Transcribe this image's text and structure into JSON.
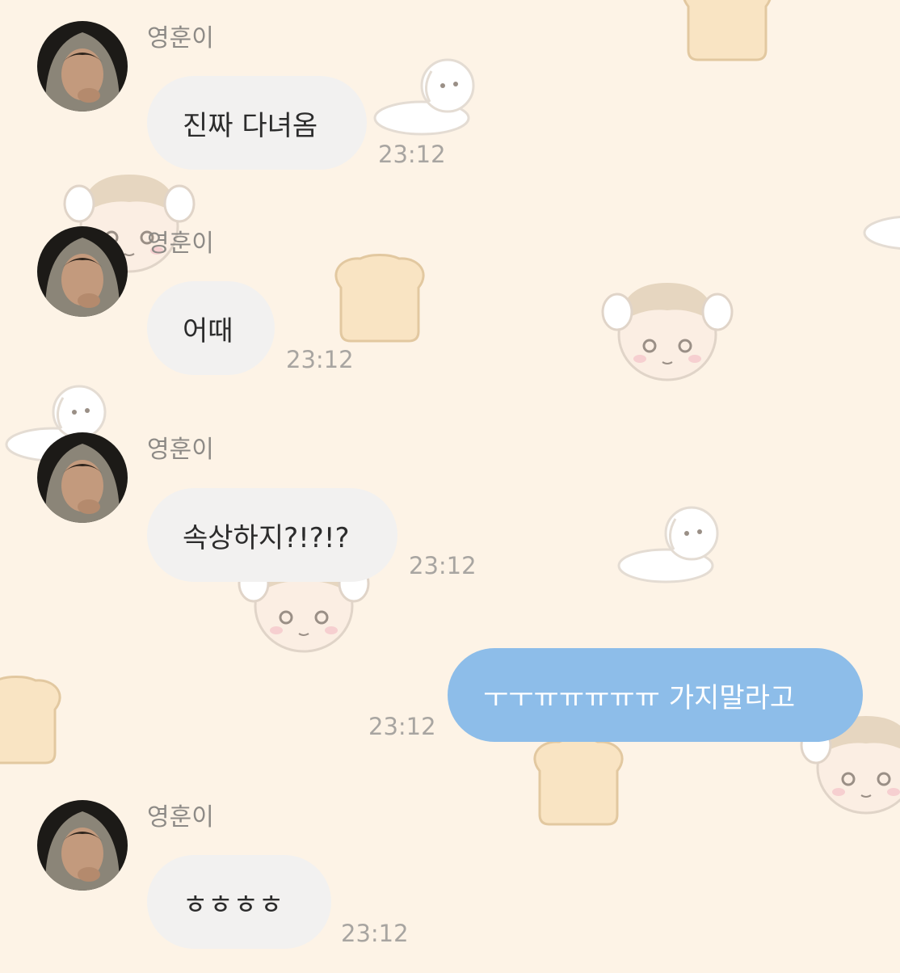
{
  "chat": {
    "messages": [
      {
        "sender": "영훈이",
        "text": "진짜 다녀옴",
        "time": "23:12",
        "direction": "incoming"
      },
      {
        "sender": "영훈이",
        "text": "어때",
        "time": "23:12",
        "direction": "incoming"
      },
      {
        "sender": "영훈이",
        "text": "속상하지?!?!?",
        "time": "23:12",
        "direction": "incoming"
      },
      {
        "text": "ㅜㅜㅠㅠㅠㅠㅠ 가지말라고",
        "time": "23:12",
        "direction": "outgoing"
      },
      {
        "sender": "영훈이",
        "text": "ㅎㅎㅎㅎ",
        "time": "23:12",
        "direction": "incoming"
      }
    ]
  },
  "colors": {
    "background": "#fdf3e6",
    "incoming_bubble": "#f2f1f0",
    "outgoing_bubble": "#8dbde9",
    "timestamp": "#a8a5a1"
  },
  "icons": {
    "wallpaper": [
      "bread-icon",
      "puppy-icon",
      "boy-face-icon"
    ]
  }
}
